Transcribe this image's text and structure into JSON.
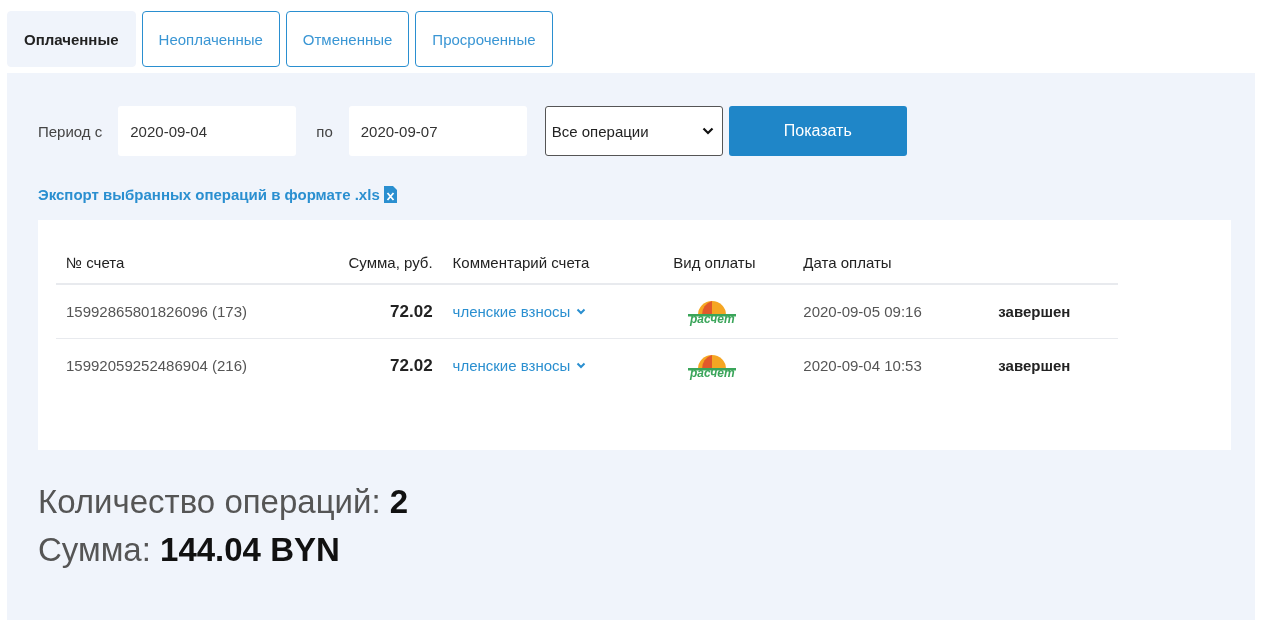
{
  "tabs": [
    {
      "label": "Оплаченные",
      "selected": true
    },
    {
      "label": "Неоплаченные",
      "selected": false
    },
    {
      "label": "Отмененные",
      "selected": false
    },
    {
      "label": "Просроченные",
      "selected": false
    }
  ],
  "filter": {
    "from_label": "Период с",
    "from_value": "2020-09-04",
    "to_label": "по",
    "to_value": "2020-09-07",
    "operation": "Все операции",
    "submit": "Показать"
  },
  "export_link": "Экспорт выбранных операций в формате .xls",
  "table": {
    "columns": [
      "№ счета",
      "Сумма, руб.",
      "Комментарий счета",
      "Вид оплаты",
      "Дата оплаты"
    ],
    "rows": [
      {
        "account": "15992865801826096 (173)",
        "amount": "72.02",
        "comment": "членские взносы",
        "payment_logo": "расчет",
        "date": "2020-09-05 09:16",
        "status": "завершен"
      },
      {
        "account": "15992059252486904 (216)",
        "amount": "72.02",
        "comment": "членские взносы",
        "payment_logo": "расчет",
        "date": "2020-09-04 10:53",
        "status": "завершен"
      }
    ]
  },
  "summary": {
    "count_label": "Количество операций:",
    "count": "2",
    "sum_label": "Сумма:",
    "sum": "144.04 BYN"
  }
}
